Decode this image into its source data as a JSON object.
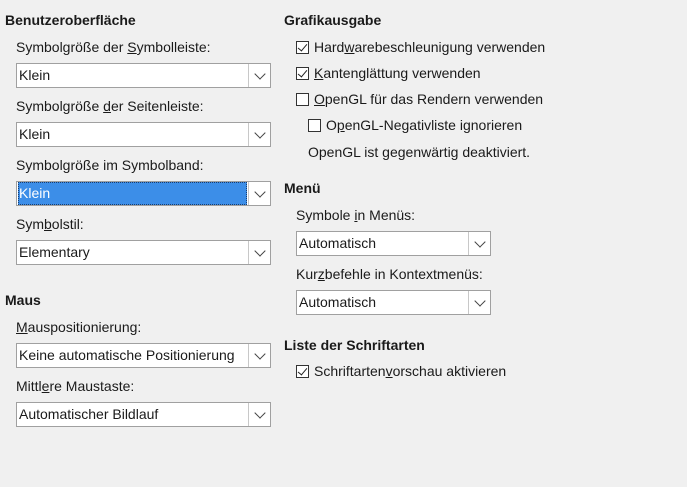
{
  "ui": {
    "title": "Benutzeroberfläche",
    "toolbar_size": {
      "label_pre": "Symbolgröße der ",
      "label_ul": "S",
      "label_post": "ymbolleiste:",
      "value": "Klein"
    },
    "sidebar_size": {
      "label_pre": "Symbolgröße ",
      "label_ul": "d",
      "label_post": "er Seitenleiste:",
      "value": "Klein"
    },
    "ribbon_size": {
      "label": "Symbolgröße im Symbolband:",
      "value": "Klein"
    },
    "style": {
      "label_pre": "Sym",
      "label_ul": "b",
      "label_post": "olstil:",
      "value": "Elementary"
    }
  },
  "mouse": {
    "title": "Maus",
    "positioning": {
      "label_ul": "M",
      "label_post": "auspositionierung:",
      "value": "Keine automatische Positionierung"
    },
    "middle": {
      "label_pre": "Mittl",
      "label_ul": "e",
      "label_post": "re Maustaste:",
      "value": "Automatischer Bildlauf"
    }
  },
  "graphics": {
    "title": "Grafikausgabe",
    "hw_accel": {
      "pre": "Hard",
      "ul": "w",
      "post": "arebeschleunigung verwenden",
      "checked": true
    },
    "antialias": {
      "pre": "",
      "ul": "K",
      "post": "antenglättung verwenden",
      "checked": true
    },
    "opengl": {
      "pre": "",
      "ul": "O",
      "post": "penGL für das Rendern verwenden",
      "checked": false
    },
    "opengl_blacklist": {
      "pre": "O",
      "ul": "p",
      "post": "enGL-Negativliste ignorieren",
      "checked": false
    },
    "status": "OpenGL ist gegenwärtig deaktiviert."
  },
  "menu": {
    "title": "Menü",
    "icons": {
      "label_pre": "Symbole ",
      "label_ul": "i",
      "label_post": "n Menüs:",
      "value": "Automatisch"
    },
    "shortcuts": {
      "label_pre": "Kur",
      "label_ul": "z",
      "label_post": "befehle in Kontextmenüs:",
      "value": "Automatisch"
    }
  },
  "fonts": {
    "title": "Liste der Schriftarten",
    "preview": {
      "pre": "Schriftarten",
      "ul": "v",
      "post": "orschau aktivieren",
      "checked": true
    }
  }
}
